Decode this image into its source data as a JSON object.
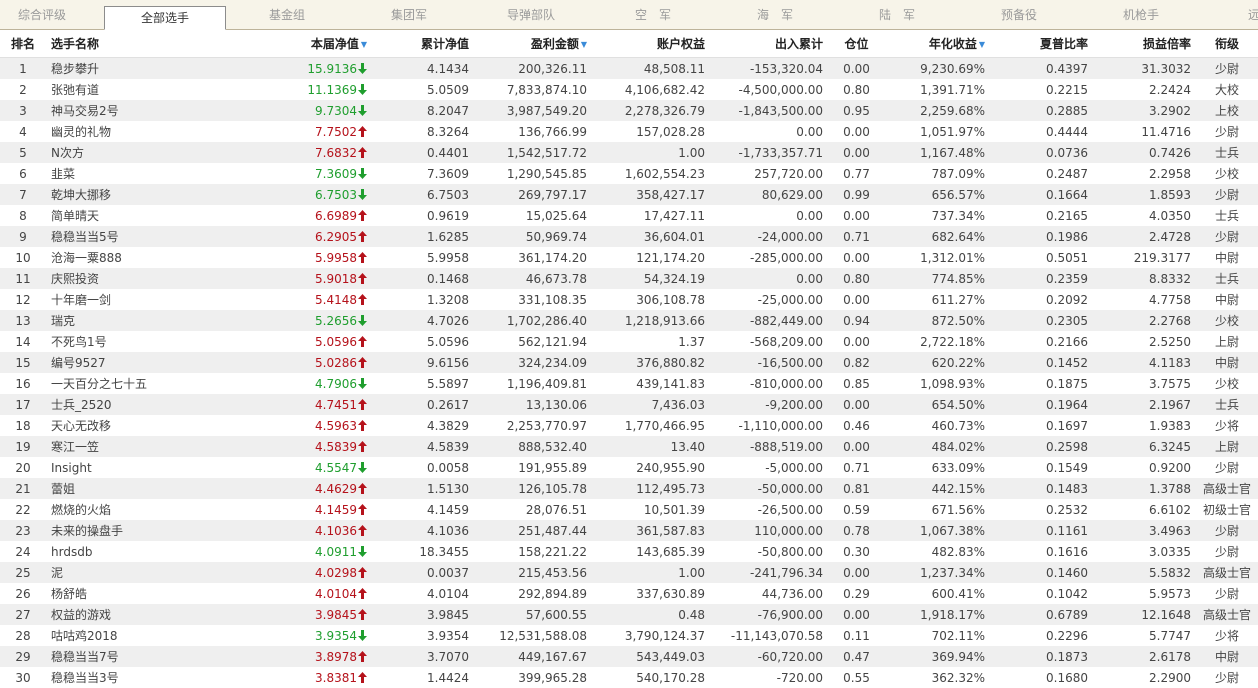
{
  "tabs": [
    {
      "label": "综合评级",
      "active": false
    },
    {
      "label": "全部选手",
      "active": true
    },
    {
      "label": "基金组",
      "active": false
    },
    {
      "label": "集团军",
      "active": false
    },
    {
      "label": "导弹部队",
      "active": false
    },
    {
      "label": "空　军",
      "active": false
    },
    {
      "label": "海　军",
      "active": false
    },
    {
      "label": "陆　军",
      "active": false
    },
    {
      "label": "预备役",
      "active": false
    },
    {
      "label": "机枪手",
      "active": false
    },
    {
      "label": "远征",
      "active": false
    }
  ],
  "columns": {
    "rank": "排名",
    "name": "选手名称",
    "nav": "本届净值",
    "cum_nav": "累计净值",
    "profit": "盈利金额",
    "equity": "账户权益",
    "cash": "出入累计",
    "position": "仓位",
    "annual": "年化收益",
    "sharpe": "夏普比率",
    "pl_ratio": "损益倍率",
    "title": "衔级"
  },
  "colors": {
    "up": "#b5121b",
    "down": "#1f9e2e",
    "sort": "#3a8bd8"
  },
  "rows": [
    {
      "rank": "1",
      "name": "稳步攀升",
      "nav": "15.9136",
      "dir": "down",
      "cum_nav": "4.1434",
      "profit": "200,326.11",
      "equity": "48,508.11",
      "cash": "-153,320.04",
      "position": "0.00",
      "annual": "9,230.69%",
      "sharpe": "0.4397",
      "pl_ratio": "31.3032",
      "title": "少尉"
    },
    {
      "rank": "2",
      "name": "张弛有道",
      "nav": "11.1369",
      "dir": "down",
      "cum_nav": "5.0509",
      "profit": "7,833,874.10",
      "equity": "4,106,682.42",
      "cash": "-4,500,000.00",
      "position": "0.80",
      "annual": "1,391.71%",
      "sharpe": "0.2215",
      "pl_ratio": "2.2424",
      "title": "大校"
    },
    {
      "rank": "3",
      "name": "神马交易2号",
      "nav": "9.7304",
      "dir": "down",
      "cum_nav": "8.2047",
      "profit": "3,987,549.20",
      "equity": "2,278,326.79",
      "cash": "-1,843,500.00",
      "position": "0.95",
      "annual": "2,259.68%",
      "sharpe": "0.2885",
      "pl_ratio": "3.2902",
      "title": "上校"
    },
    {
      "rank": "4",
      "name": "幽灵的礼物",
      "nav": "7.7502",
      "dir": "up",
      "cum_nav": "8.3264",
      "profit": "136,766.99",
      "equity": "157,028.28",
      "cash": "0.00",
      "position": "0.00",
      "annual": "1,051.97%",
      "sharpe": "0.4444",
      "pl_ratio": "11.4716",
      "title": "少尉"
    },
    {
      "rank": "5",
      "name": "N次方",
      "nav": "7.6832",
      "dir": "up",
      "cum_nav": "0.4401",
      "profit": "1,542,517.72",
      "equity": "1.00",
      "cash": "-1,733,357.71",
      "position": "0.00",
      "annual": "1,167.48%",
      "sharpe": "0.0736",
      "pl_ratio": "0.7426",
      "title": "士兵"
    },
    {
      "rank": "6",
      "name": "韭菜",
      "nav": "7.3609",
      "dir": "down",
      "cum_nav": "7.3609",
      "profit": "1,290,545.85",
      "equity": "1,602,554.23",
      "cash": "257,720.00",
      "position": "0.77",
      "annual": "787.09%",
      "sharpe": "0.2487",
      "pl_ratio": "2.2958",
      "title": "少校"
    },
    {
      "rank": "7",
      "name": "乾坤大挪移",
      "nav": "6.7503",
      "dir": "down",
      "cum_nav": "6.7503",
      "profit": "269,797.17",
      "equity": "358,427.17",
      "cash": "80,629.00",
      "position": "0.99",
      "annual": "656.57%",
      "sharpe": "0.1664",
      "pl_ratio": "1.8593",
      "title": "少尉"
    },
    {
      "rank": "8",
      "name": "简单晴天",
      "nav": "6.6989",
      "dir": "up",
      "cum_nav": "0.9619",
      "profit": "15,025.64",
      "equity": "17,427.11",
      "cash": "0.00",
      "position": "0.00",
      "annual": "737.34%",
      "sharpe": "0.2165",
      "pl_ratio": "4.0350",
      "title": "士兵"
    },
    {
      "rank": "9",
      "name": "稳稳当当5号",
      "nav": "6.2905",
      "dir": "up",
      "cum_nav": "1.6285",
      "profit": "50,969.74",
      "equity": "36,604.01",
      "cash": "-24,000.00",
      "position": "0.71",
      "annual": "682.64%",
      "sharpe": "0.1986",
      "pl_ratio": "2.4728",
      "title": "少尉"
    },
    {
      "rank": "10",
      "name": "沧海一粟888",
      "nav": "5.9958",
      "dir": "up",
      "cum_nav": "5.9958",
      "profit": "361,174.20",
      "equity": "121,174.20",
      "cash": "-285,000.00",
      "position": "0.00",
      "annual": "1,312.01%",
      "sharpe": "0.5051",
      "pl_ratio": "219.3177",
      "title": "中尉"
    },
    {
      "rank": "11",
      "name": "庆熙投资",
      "nav": "5.9018",
      "dir": "up",
      "cum_nav": "0.1468",
      "profit": "46,673.78",
      "equity": "54,324.19",
      "cash": "0.00",
      "position": "0.80",
      "annual": "774.85%",
      "sharpe": "0.2359",
      "pl_ratio": "8.8332",
      "title": "士兵"
    },
    {
      "rank": "12",
      "name": "十年磨一剑",
      "nav": "5.4148",
      "dir": "up",
      "cum_nav": "1.3208",
      "profit": "331,108.35",
      "equity": "306,108.78",
      "cash": "-25,000.00",
      "position": "0.00",
      "annual": "611.27%",
      "sharpe": "0.2092",
      "pl_ratio": "4.7758",
      "title": "中尉"
    },
    {
      "rank": "13",
      "name": "瑞克",
      "nav": "5.2656",
      "dir": "down",
      "cum_nav": "4.7026",
      "profit": "1,702,286.40",
      "equity": "1,218,913.66",
      "cash": "-882,449.00",
      "position": "0.94",
      "annual": "872.50%",
      "sharpe": "0.2305",
      "pl_ratio": "2.2768",
      "title": "少校"
    },
    {
      "rank": "14",
      "name": "不死鸟1号",
      "nav": "5.0596",
      "dir": "up",
      "cum_nav": "5.0596",
      "profit": "562,121.94",
      "equity": "1.37",
      "cash": "-568,209.00",
      "position": "0.00",
      "annual": "2,722.18%",
      "sharpe": "0.2166",
      "pl_ratio": "2.5250",
      "title": "上尉"
    },
    {
      "rank": "15",
      "name": "编号9527",
      "nav": "5.0286",
      "dir": "up",
      "cum_nav": "9.6156",
      "profit": "324,234.09",
      "equity": "376,880.82",
      "cash": "-16,500.00",
      "position": "0.82",
      "annual": "620.22%",
      "sharpe": "0.1452",
      "pl_ratio": "4.1183",
      "title": "中尉"
    },
    {
      "rank": "16",
      "name": "一天百分之七十五",
      "nav": "4.7906",
      "dir": "down",
      "cum_nav": "5.5897",
      "profit": "1,196,409.81",
      "equity": "439,141.83",
      "cash": "-810,000.00",
      "position": "0.85",
      "annual": "1,098.93%",
      "sharpe": "0.1875",
      "pl_ratio": "3.7575",
      "title": "少校"
    },
    {
      "rank": "17",
      "name": "士兵_2520",
      "nav": "4.7451",
      "dir": "up",
      "cum_nav": "0.2617",
      "profit": "13,130.06",
      "equity": "7,436.03",
      "cash": "-9,200.00",
      "position": "0.00",
      "annual": "654.50%",
      "sharpe": "0.1964",
      "pl_ratio": "2.1967",
      "title": "士兵"
    },
    {
      "rank": "18",
      "name": "天心无改移",
      "nav": "4.5963",
      "dir": "up",
      "cum_nav": "4.3829",
      "profit": "2,253,770.97",
      "equity": "1,770,466.95",
      "cash": "-1,110,000.00",
      "position": "0.46",
      "annual": "460.73%",
      "sharpe": "0.1697",
      "pl_ratio": "1.9383",
      "title": "少将"
    },
    {
      "rank": "19",
      "name": "寒江一笠",
      "nav": "4.5839",
      "dir": "up",
      "cum_nav": "4.5839",
      "profit": "888,532.40",
      "equity": "13.40",
      "cash": "-888,519.00",
      "position": "0.00",
      "annual": "484.02%",
      "sharpe": "0.2598",
      "pl_ratio": "6.3245",
      "title": "上尉"
    },
    {
      "rank": "20",
      "name": "Insight",
      "nav": "4.5547",
      "dir": "down",
      "cum_nav": "0.0058",
      "profit": "191,955.89",
      "equity": "240,955.90",
      "cash": "-5,000.00",
      "position": "0.71",
      "annual": "633.09%",
      "sharpe": "0.1549",
      "pl_ratio": "0.9200",
      "title": "少尉"
    },
    {
      "rank": "21",
      "name": "蕾姐",
      "nav": "4.4629",
      "dir": "up",
      "cum_nav": "1.5130",
      "profit": "126,105.78",
      "equity": "112,495.73",
      "cash": "-50,000.00",
      "position": "0.81",
      "annual": "442.15%",
      "sharpe": "0.1483",
      "pl_ratio": "1.3788",
      "title": "高级士官"
    },
    {
      "rank": "22",
      "name": "燃烧的火焰",
      "nav": "4.1459",
      "dir": "up",
      "cum_nav": "4.1459",
      "profit": "28,076.51",
      "equity": "10,501.39",
      "cash": "-26,500.00",
      "position": "0.59",
      "annual": "671.56%",
      "sharpe": "0.2532",
      "pl_ratio": "6.6102",
      "title": "初级士官"
    },
    {
      "rank": "23",
      "name": "未来的操盘手",
      "nav": "4.1036",
      "dir": "up",
      "cum_nav": "4.1036",
      "profit": "251,487.44",
      "equity": "361,587.83",
      "cash": "110,000.00",
      "position": "0.78",
      "annual": "1,067.38%",
      "sharpe": "0.1161",
      "pl_ratio": "3.4963",
      "title": "少尉"
    },
    {
      "rank": "24",
      "name": "hrdsdb",
      "nav": "4.0911",
      "dir": "down",
      "cum_nav": "18.3455",
      "profit": "158,221.22",
      "equity": "143,685.39",
      "cash": "-50,800.00",
      "position": "0.30",
      "annual": "482.83%",
      "sharpe": "0.1616",
      "pl_ratio": "3.0335",
      "title": "少尉"
    },
    {
      "rank": "25",
      "name": "泥",
      "nav": "4.0298",
      "dir": "up",
      "cum_nav": "0.0037",
      "profit": "215,453.56",
      "equity": "1.00",
      "cash": "-241,796.34",
      "position": "0.00",
      "annual": "1,237.34%",
      "sharpe": "0.1460",
      "pl_ratio": "5.5832",
      "title": "高级士官"
    },
    {
      "rank": "26",
      "name": "杨舒皓",
      "nav": "4.0104",
      "dir": "up",
      "cum_nav": "4.0104",
      "profit": "292,894.89",
      "equity": "337,630.89",
      "cash": "44,736.00",
      "position": "0.29",
      "annual": "600.41%",
      "sharpe": "0.1042",
      "pl_ratio": "5.9573",
      "title": "少尉"
    },
    {
      "rank": "27",
      "name": "权益的游戏",
      "nav": "3.9845",
      "dir": "up",
      "cum_nav": "3.9845",
      "profit": "57,600.55",
      "equity": "0.48",
      "cash": "-76,900.00",
      "position": "0.00",
      "annual": "1,918.17%",
      "sharpe": "0.6789",
      "pl_ratio": "12.1648",
      "title": "高级士官"
    },
    {
      "rank": "28",
      "name": "咕咕鸡2018",
      "nav": "3.9354",
      "dir": "down",
      "cum_nav": "3.9354",
      "profit": "12,531,588.08",
      "equity": "3,790,124.37",
      "cash": "-11,143,070.58",
      "position": "0.11",
      "annual": "702.11%",
      "sharpe": "0.2296",
      "pl_ratio": "5.7747",
      "title": "少将"
    },
    {
      "rank": "29",
      "name": "稳稳当当7号",
      "nav": "3.8978",
      "dir": "up",
      "cum_nav": "3.7070",
      "profit": "449,167.67",
      "equity": "543,449.03",
      "cash": "-60,720.00",
      "position": "0.47",
      "annual": "369.94%",
      "sharpe": "0.1873",
      "pl_ratio": "2.6178",
      "title": "中尉"
    },
    {
      "rank": "30",
      "name": "稳稳当当3号",
      "nav": "3.8381",
      "dir": "up",
      "cum_nav": "1.4424",
      "profit": "399,965.28",
      "equity": "540,170.28",
      "cash": "-720.00",
      "position": "0.55",
      "annual": "362.32%",
      "sharpe": "0.1680",
      "pl_ratio": "2.2900",
      "title": "少尉"
    }
  ]
}
